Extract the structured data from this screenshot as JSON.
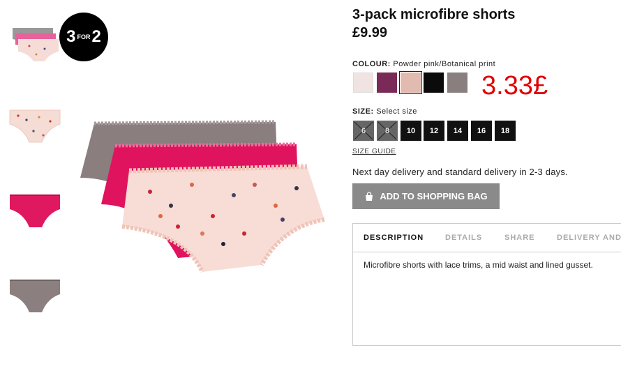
{
  "badge": {
    "big_left": "3",
    "small": "FOR",
    "big_right": "2"
  },
  "product": {
    "title": "3-pack microfibre shorts",
    "price": "£9.99"
  },
  "colour": {
    "label": "COLOUR:",
    "value": "Powder pink/Botanical print",
    "swatches": [
      {
        "name": "light pink",
        "color": "#f1e3e1"
      },
      {
        "name": "plum",
        "color": "#7a2a56"
      },
      {
        "name": "Powder pink/Botanical print",
        "color": "#e2bbb0",
        "selected": true
      },
      {
        "name": "black",
        "color": "#0b0b0b"
      },
      {
        "name": "taupe",
        "color": "#8a7f7f"
      }
    ]
  },
  "annotation": "3.33£",
  "size": {
    "label": "SIZE:",
    "value": "Select size",
    "options": [
      {
        "label": "6",
        "available": false
      },
      {
        "label": "8",
        "available": false
      },
      {
        "label": "10",
        "available": true
      },
      {
        "label": "12",
        "available": true
      },
      {
        "label": "14",
        "available": true
      },
      {
        "label": "16",
        "available": true
      },
      {
        "label": "18",
        "available": true
      }
    ],
    "guide": "SIZE GUIDE"
  },
  "delivery": "Next day delivery and standard delivery in 2-3 days.",
  "add_to_bag": "ADD TO SHOPPING BAG",
  "tabs": [
    {
      "label": "DESCRIPTION",
      "active": true
    },
    {
      "label": "DETAILS",
      "active": false
    },
    {
      "label": "SHARE",
      "active": false
    },
    {
      "label": "DELIVERY AND",
      "active": false
    }
  ],
  "description": "Microfibre shorts with lace trims, a mid waist and lined gusset.",
  "colors": {
    "accent_red": "#e00000",
    "button_grey": "#8a8a8a"
  },
  "icons": [
    "bag-icon",
    "cross-icon"
  ]
}
